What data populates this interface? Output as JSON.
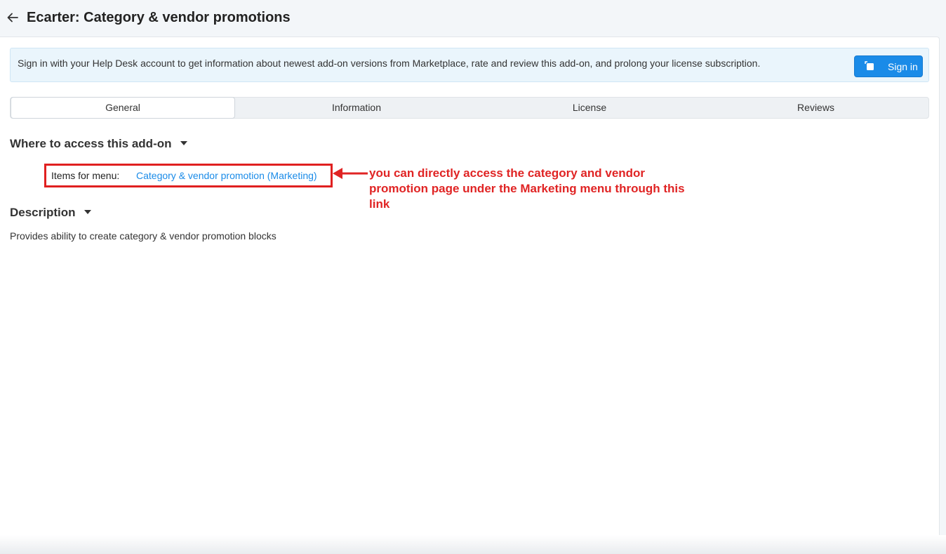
{
  "header": {
    "title": "Ecarter: Category & vendor promotions",
    "back_icon": "arrow-left-icon"
  },
  "notice": {
    "text": "Sign in with your Help Desk account to get information about newest add-on versions from Marketplace, rate and review this add-on, and prolong your license subscription.",
    "signin_label": "Sign in",
    "signin_icon": "sign-in-icon",
    "colors": {
      "background": "#eaf5fc",
      "button": "#1a8be8"
    }
  },
  "tabs": [
    {
      "label": "General",
      "active": true
    },
    {
      "label": "Information",
      "active": false
    },
    {
      "label": "License",
      "active": false
    },
    {
      "label": "Reviews",
      "active": false
    }
  ],
  "sections": {
    "access": {
      "heading": "Where to access this add-on",
      "items_label": "Items for menu:",
      "link_text": "Category & vendor promotion (Marketing)"
    },
    "description": {
      "heading": "Description",
      "text": "Provides ability to create category & vendor promotion blocks"
    }
  },
  "annotation": {
    "text": "you can directly access the category and vendor promotion page under the Marketing menu through this link",
    "color": "#e02424"
  },
  "colors": {
    "link": "#1a8be8",
    "highlight_box": "#e02020"
  }
}
